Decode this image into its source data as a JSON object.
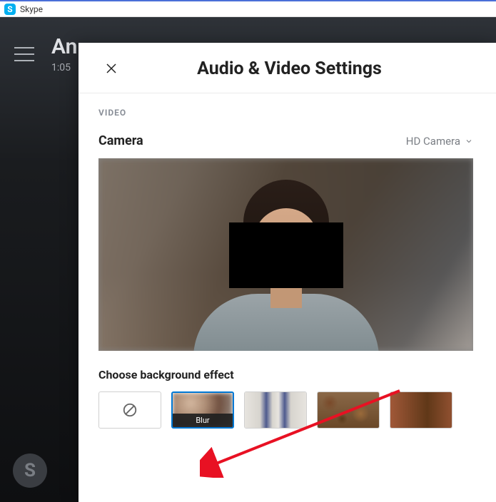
{
  "window": {
    "app_name": "Skype",
    "icon_letter": "S"
  },
  "background_call": {
    "title_partial": "An",
    "time": "1:05",
    "logo_letter": "S"
  },
  "panel": {
    "title": "Audio & Video Settings",
    "section_label": "VIDEO",
    "camera_label": "Camera",
    "camera_selected": "HD Camera",
    "effect_label": "Choose background effect",
    "effects": [
      {
        "id": "none",
        "label": ""
      },
      {
        "id": "blur",
        "label": "Blur",
        "selected": true
      },
      {
        "id": "bg-tiles",
        "label": ""
      },
      {
        "id": "bg-warm1",
        "label": ""
      },
      {
        "id": "bg-warm2",
        "label": ""
      }
    ]
  }
}
